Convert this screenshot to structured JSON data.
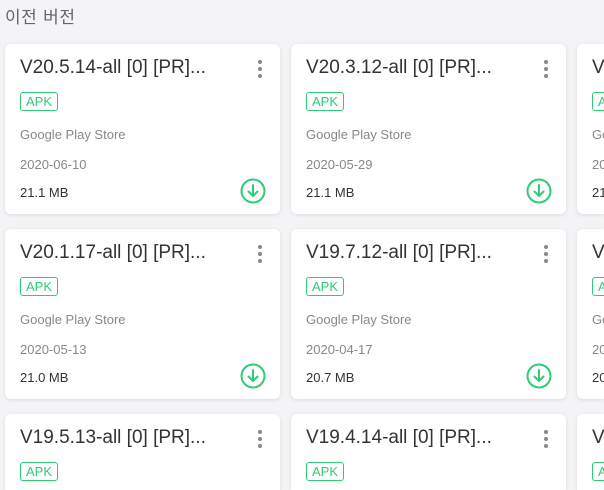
{
  "section": {
    "title": "이전 버전"
  },
  "cards": [
    {
      "title": "V20.5.14-all [0] [PR]...",
      "badge": "APK",
      "store": "Google Play Store",
      "date": "2020-06-10",
      "size": "21.1 MB"
    },
    {
      "title": "V20.3.12-all [0] [PR]...",
      "badge": "APK",
      "store": "Google Play Store",
      "date": "2020-05-29",
      "size": "21.1 MB"
    },
    {
      "title": "V20.1.17-all [0] [PR]...",
      "badge": "APK",
      "store": "Google Play Store",
      "date": "2020-05-13",
      "size": "21.0 MB"
    },
    {
      "title": "V19.7.12-all [0] [PR]...",
      "badge": "APK",
      "store": "Google Play Store",
      "date": "2020-04-17",
      "size": "20.7 MB"
    },
    {
      "title": "V19.5.13-all [0] [PR]...",
      "badge": "APK"
    },
    {
      "title": "V19.4.14-all [0] [PR]...",
      "badge": "APK"
    }
  ],
  "partial_cards": [
    {
      "title": "V",
      "badge": "A",
      "store": "Go",
      "date": "20",
      "size": "21"
    },
    {
      "title": "V",
      "badge": "A",
      "store": "Go",
      "date": "20",
      "size": "20"
    },
    {
      "title": "V",
      "badge": "A"
    }
  ],
  "colors": {
    "accent": "#2fcb75",
    "background": "#f4f4f6"
  },
  "icons": {
    "menu": "more-vertical-icon",
    "download": "download-circle-icon"
  }
}
